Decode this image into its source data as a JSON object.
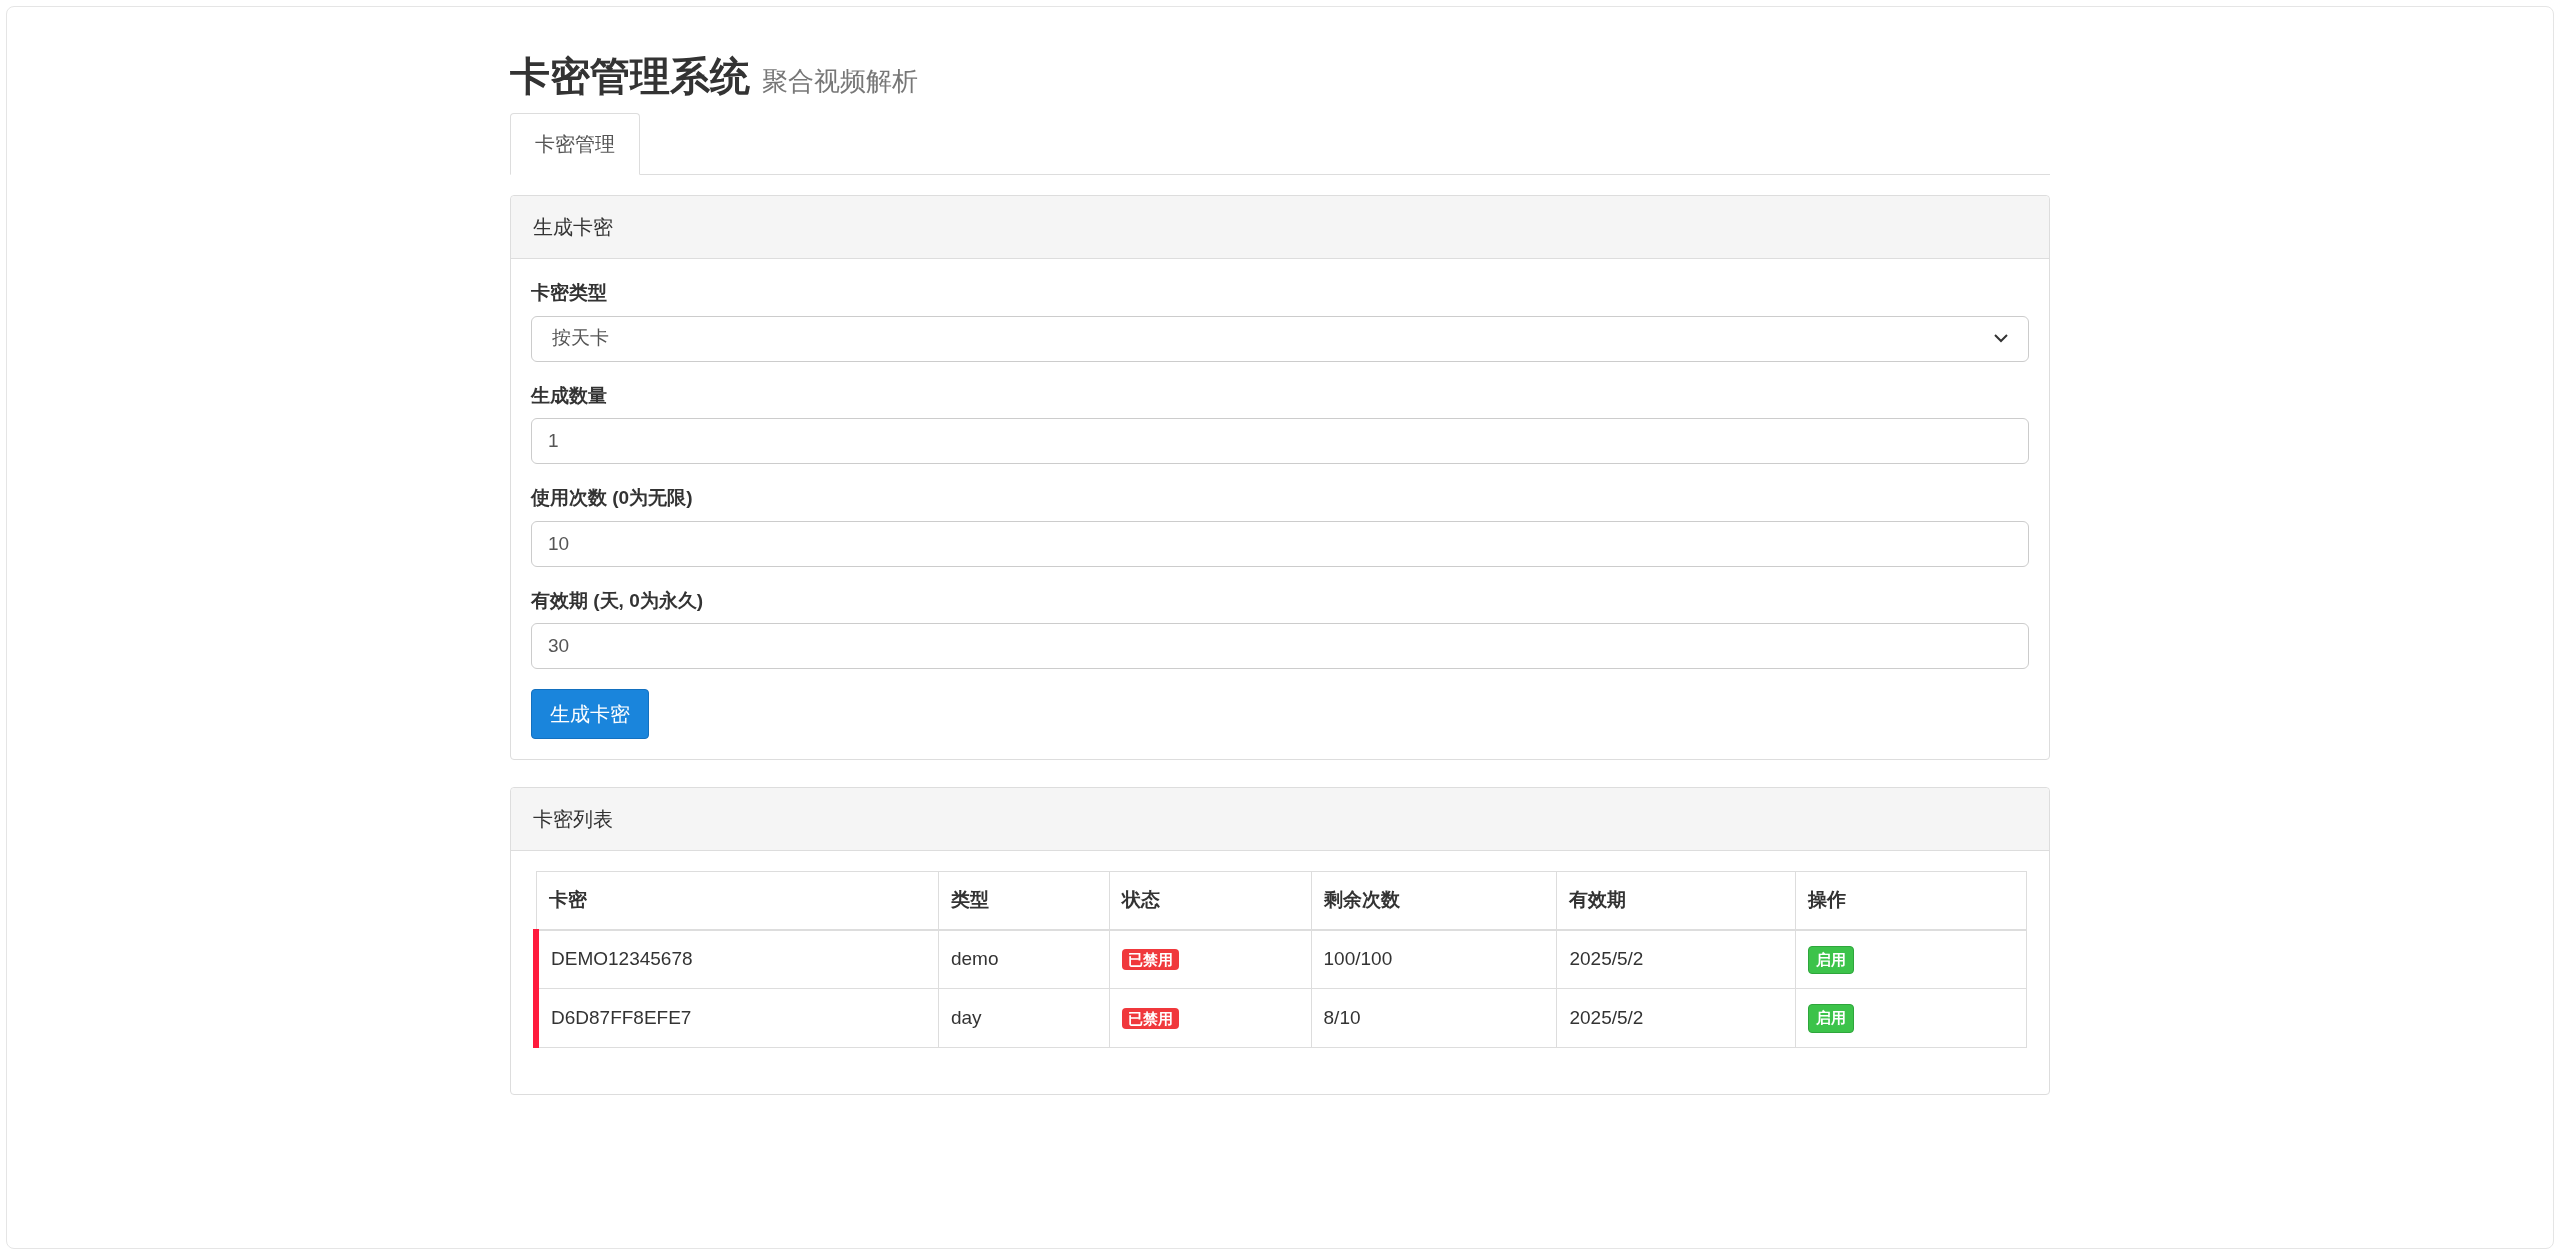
{
  "header": {
    "title": "卡密管理系统",
    "subtitle": "聚合视频解析"
  },
  "tabs": [
    {
      "label": "卡密管理",
      "selected": true
    }
  ],
  "generate_panel": {
    "title": "生成卡密",
    "fields": [
      {
        "kind": "select",
        "label": "卡密类型",
        "value": "按天卡"
      },
      {
        "kind": "input",
        "label": "生成数量",
        "value": "1"
      },
      {
        "kind": "input",
        "label": "使用次数 (0为无限)",
        "value": "10"
      },
      {
        "kind": "input",
        "label": "有效期 (天, 0为永久)",
        "value": "30"
      }
    ],
    "button": "生成卡密"
  },
  "list_panel": {
    "title": "卡密列表",
    "table": {
      "columns": [
        "卡密",
        "类型",
        "状态",
        "剩余次数",
        "有效期",
        "操作"
      ],
      "rows": [
        {
          "disabled": true,
          "card": "DEMO12345678",
          "type": "demo",
          "status": "已禁用",
          "remaining": "100/100",
          "expiry": "2025/5/2",
          "action": "启用"
        },
        {
          "disabled": true,
          "card": "D6D87FF8EFE7",
          "type": "day",
          "status": "已禁用",
          "remaining": "8/10",
          "expiry": "2025/5/2",
          "action": "启用"
        }
      ]
    }
  }
}
